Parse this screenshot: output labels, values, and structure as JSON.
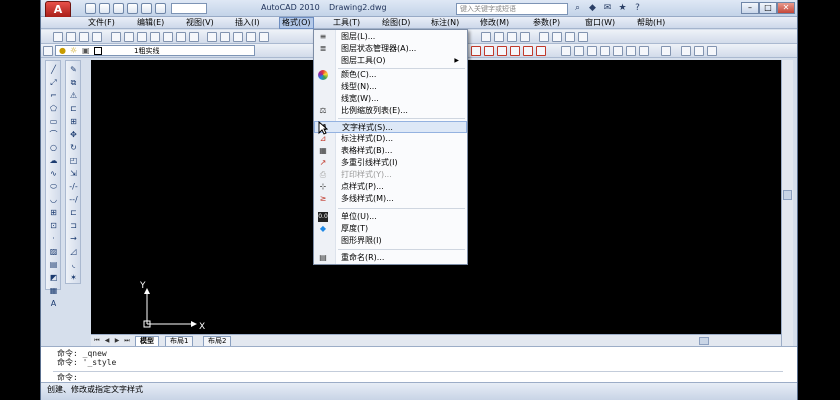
{
  "titlebar": {
    "app_title": "AutoCAD 2010",
    "doc_title": "Drawing2.dwg",
    "search_placeholder": "键入关键字或短语",
    "app_button_label": "A"
  },
  "menubar": {
    "items": [
      "文件(F)",
      "编辑(E)",
      "视图(V)",
      "插入(I)",
      "格式(O)",
      "工具(T)",
      "绘图(D)",
      "标注(N)",
      "修改(M)",
      "参数(P)",
      "窗口(W)",
      "帮助(H)"
    ],
    "active_index": 4
  },
  "layer_toolbar": {
    "current_layer": "1粗实线"
  },
  "format_menu": {
    "items": [
      {
        "label": "图层(L)...",
        "icon": "layers-icon"
      },
      {
        "label": "图层状态管理器(A)...",
        "icon": "layer-states-icon"
      },
      {
        "label": "图层工具(O)",
        "icon": "",
        "submenu": true
      },
      {
        "label": "颜色(C)...",
        "icon": "color-wheel-icon"
      },
      {
        "label": "线型(N)...",
        "icon": ""
      },
      {
        "label": "线宽(W)...",
        "icon": ""
      },
      {
        "label": "比例缩放列表(E)...",
        "icon": "scale-list-icon"
      },
      {
        "label": "文字样式(S)...",
        "icon": "text-style-icon",
        "highlighted": true
      },
      {
        "label": "标注样式(D)...",
        "icon": "dim-style-icon"
      },
      {
        "label": "表格样式(B)...",
        "icon": "table-style-icon"
      },
      {
        "label": "多重引线样式(I)",
        "icon": "mleader-style-icon"
      },
      {
        "label": "打印样式(Y)...",
        "icon": "plot-style-icon",
        "disabled": true
      },
      {
        "label": "点样式(P)...",
        "icon": "point-style-icon"
      },
      {
        "label": "多线样式(M)...",
        "icon": "mline-style-icon"
      },
      {
        "label": "单位(U)...",
        "icon": "units-icon"
      },
      {
        "label": "厚度(T)",
        "icon": "thickness-icon"
      },
      {
        "label": "图形界限(I)",
        "icon": ""
      },
      {
        "label": "重命名(R)...",
        "icon": "rename-icon"
      }
    ]
  },
  "layout_tabs": [
    "模型",
    "布局1",
    "布局2"
  ],
  "ucs": {
    "x_label": "X",
    "y_label": "Y"
  },
  "command_line": {
    "history": [
      "命令: _qnew",
      "命令: '_style"
    ],
    "prompt": "命令:"
  },
  "status_bar": {
    "text": "创建、修改或指定文字样式"
  },
  "colors": {
    "drawing_bg": "#000000",
    "menu_highlight": "#dde8f7",
    "app_button": "#c0392b"
  }
}
